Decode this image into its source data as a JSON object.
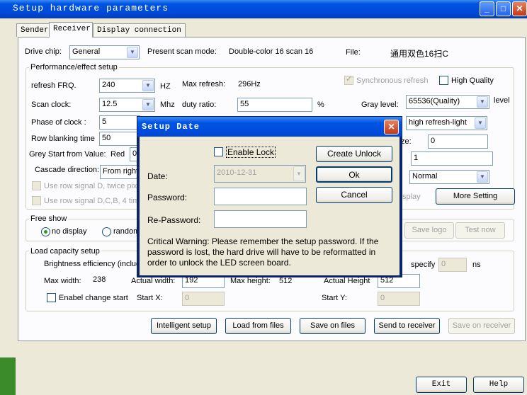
{
  "window": {
    "title": "Setup hardware parameters",
    "minimize": "_",
    "maximize": "□",
    "close": "✕"
  },
  "tabs": [
    "Sender",
    "Receiver",
    "Display connection"
  ],
  "top": {
    "drive_chip_label": "Drive chip:",
    "drive_chip_value": "General",
    "scan_mode_label": "Present scan mode:",
    "scan_mode_value": "Double-color 16 scan 16",
    "file_label": "File:",
    "file_value": "通用双色16扫C"
  },
  "perf": {
    "title": "Performance/effect setup",
    "refresh_label": "refresh FRQ.",
    "refresh_value": "240",
    "refresh_unit": "HZ",
    "max_refresh_label": "Max refresh:",
    "max_refresh_value": "296Hz",
    "sync_refresh": "Synchronous refresh",
    "high_quality": "High Quality",
    "scan_clock_label": "Scan clock:",
    "scan_clock_value": "12.5",
    "scan_clock_unit": "Mhz",
    "duty_label": "duty ratio:",
    "duty_value": "55",
    "duty_unit": "%",
    "gray_label": "Gray level:",
    "gray_value": "65536(Quality)",
    "gray_unit": "level",
    "phase_label": "Phase of clock :",
    "phase_value": "5",
    "refresh_mode_value": "high refresh-light",
    "row_blank_label": "Row blanking time",
    "row_blank_value": "50",
    "size_suffix": "ze:",
    "size_value": "0",
    "gray_start_label": "Grey Start from Value:",
    "gray_start_red": "Red",
    "gray_start_red_value": "0",
    "field_1_value": "1",
    "cascade_label": "Cascade direction:",
    "cascade_value": "From right",
    "normal_value": "Normal",
    "row_signal_1": "Use row signal D, twice pixe",
    "row_signal_2": "Use row signal D,C,B, 4 tim",
    "display_suffix": "splay",
    "more_setting": "More  Setting"
  },
  "free_show": {
    "title": "Free show",
    "no_display": "no display",
    "random": "random",
    "save_logo": "Save logo",
    "test_now": "Test now"
  },
  "load": {
    "title": "Load capacity setup",
    "brightness_label": "Brightness efficiency (includ",
    "specify_label": "specify",
    "specify_value": "0",
    "specify_unit": "ns",
    "max_width_label": "Max width:",
    "max_width_value": "238",
    "actual_width_label": "Actual width:",
    "actual_width_value": "192",
    "max_height_label": "Max height:",
    "max_height_value": "512",
    "actual_height_label": "Actual Height",
    "actual_height_value": "512",
    "enable_change_start": "Enabel change start",
    "start_x_label": "Start X:",
    "start_x_value": "0",
    "start_y_label": "Start Y:",
    "start_y_value": "0"
  },
  "buttons": {
    "intelligent": "Intelligent setup",
    "load_files": "Load from files",
    "save_files": "Save on files",
    "send_receiver": "Send to receiver",
    "save_receiver": "Save on receiver",
    "exit": "Exit",
    "help": "Help"
  },
  "dialog": {
    "title": "Setup Date",
    "close": "✕",
    "enable_lock": "Enable Lock",
    "date_label": "Date:",
    "date_value": "2010-12-31",
    "password_label": "Password:",
    "repassword_label": "Re-Password:",
    "create_unlock": "Create Unlock",
    "ok": "Ok",
    "cancel": "Cancel",
    "warning": "Critical Warning: Please remember the setup password. If the password is lost, the hard drive will have to be reformatted in order to unlock the LED screen board."
  }
}
